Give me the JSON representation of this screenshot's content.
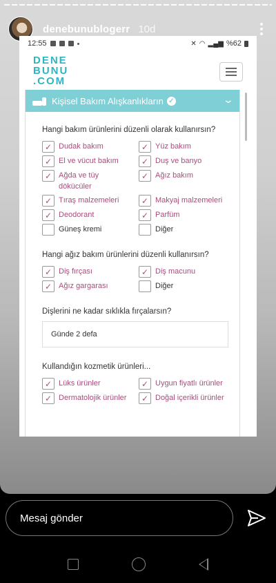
{
  "story": {
    "username": "denebunublogerr",
    "time_ago": "10d"
  },
  "phone_status": {
    "time": "12:55",
    "battery": "%62"
  },
  "site": {
    "logo_lines": [
      "DENE",
      "BUNU",
      ".COM"
    ]
  },
  "form": {
    "section_title": "Kişisel Bakım Alışkanlıkların",
    "questions": [
      {
        "text": "Hangi bakım ürünlerini düzenli olarak kullanırsın?",
        "options": [
          {
            "label": "Dudak bakım",
            "checked": true
          },
          {
            "label": "Yüz bakım",
            "checked": true
          },
          {
            "label": "El ve vücut bakım",
            "checked": true
          },
          {
            "label": "Duş ve banyo",
            "checked": true
          },
          {
            "label": "Ağda ve tüy dökücüler",
            "checked": true
          },
          {
            "label": "Ağız bakım",
            "checked": true
          },
          {
            "label": "Tıraş malzemeleri",
            "checked": true
          },
          {
            "label": "Makyaj malzemeleri",
            "checked": true
          },
          {
            "label": "Deodorant",
            "checked": true
          },
          {
            "label": "Parfüm",
            "checked": true
          },
          {
            "label": "Güneş kremi",
            "checked": false
          },
          {
            "label": "Diğer",
            "checked": false
          }
        ]
      },
      {
        "text": "Hangi ağız bakım ürünlerini düzenli kullanırsın?",
        "options": [
          {
            "label": "Diş fırçası",
            "checked": true
          },
          {
            "label": "Diş macunu",
            "checked": true
          },
          {
            "label": "Ağız gargarası",
            "checked": true
          },
          {
            "label": "Diğer",
            "checked": false
          }
        ]
      },
      {
        "text": "Dişlerini ne kadar sıklıkla fırçalarsın?",
        "answer": "Günde 2 defa"
      },
      {
        "text": "Kullandığın kozmetik ürünleri...",
        "options": [
          {
            "label": "Lüks ürünler",
            "checked": true
          },
          {
            "label": "Uygun fiyatlı ürünler",
            "checked": true
          },
          {
            "label": "Dermatolojik ürünler",
            "checked": true
          },
          {
            "label": "Doğal içerikli ürünler",
            "checked": true
          }
        ]
      }
    ]
  },
  "reply": {
    "placeholder": "Mesaj gönder"
  },
  "icons": {
    "more": "more-vertical-icon",
    "send": "send-icon",
    "menu": "hamburger-icon"
  },
  "colors": {
    "accent": "#7fcfd6",
    "checked_label": "#a94c7c"
  }
}
